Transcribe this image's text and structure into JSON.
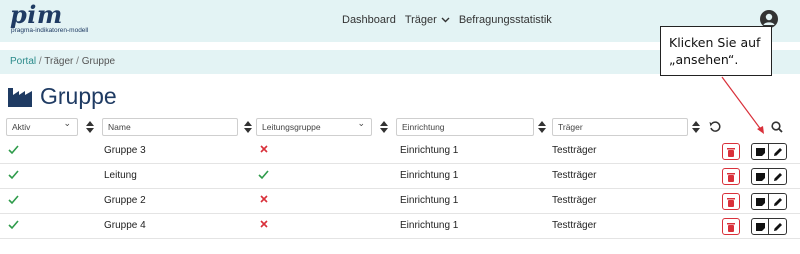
{
  "header": {
    "logo": {
      "mark": "pim",
      "subtitle": "pragma-indikatoren-modell"
    },
    "nav": [
      {
        "label": "Dashboard",
        "has_dropdown": false
      },
      {
        "label": "Träger",
        "has_dropdown": true
      },
      {
        "label": "Befragungsstatistik",
        "has_dropdown": false
      }
    ],
    "user_icon": "user-circle-icon"
  },
  "breadcrumb": {
    "items": [
      "Portal",
      "Träger",
      "Gruppe"
    ],
    "separator": "/"
  },
  "page": {
    "title": "Gruppe",
    "title_icon": "factory-icon"
  },
  "filters": {
    "aktiv": "Aktiv",
    "name": "Name",
    "leitungsgruppe": "Leitungsgruppe",
    "einrichtung": "Einrichtung",
    "traeger": "Träger",
    "reset_icon": "reset-icon",
    "search_icon": "search-icon"
  },
  "rows": [
    {
      "aktiv": true,
      "name": "Gruppe 3",
      "leitung": false,
      "einrichtung": "Einrichtung 1",
      "traeger": "Testträger"
    },
    {
      "aktiv": true,
      "name": "Leitung",
      "leitung": true,
      "einrichtung": "Einrichtung 1",
      "traeger": "Testträger"
    },
    {
      "aktiv": true,
      "name": "Gruppe 2",
      "leitung": false,
      "einrichtung": "Einrichtung 1",
      "traeger": "Testträger"
    },
    {
      "aktiv": true,
      "name": "Gruppe 4",
      "leitung": false,
      "einrichtung": "Einrichtung 1",
      "traeger": "Testträger"
    }
  ],
  "row_actions": [
    "delete-icon",
    "view-icon",
    "edit-icon"
  ],
  "callout": {
    "line1": "Klicken Sie auf",
    "line2": "„ansehen“."
  },
  "colors": {
    "header_bg": "#e3f3f4",
    "brand": "#1f3b63",
    "link": "#2a8a8a",
    "check": "#2e9b4a",
    "cross": "#d9303a",
    "arrow": "#d9303a"
  }
}
